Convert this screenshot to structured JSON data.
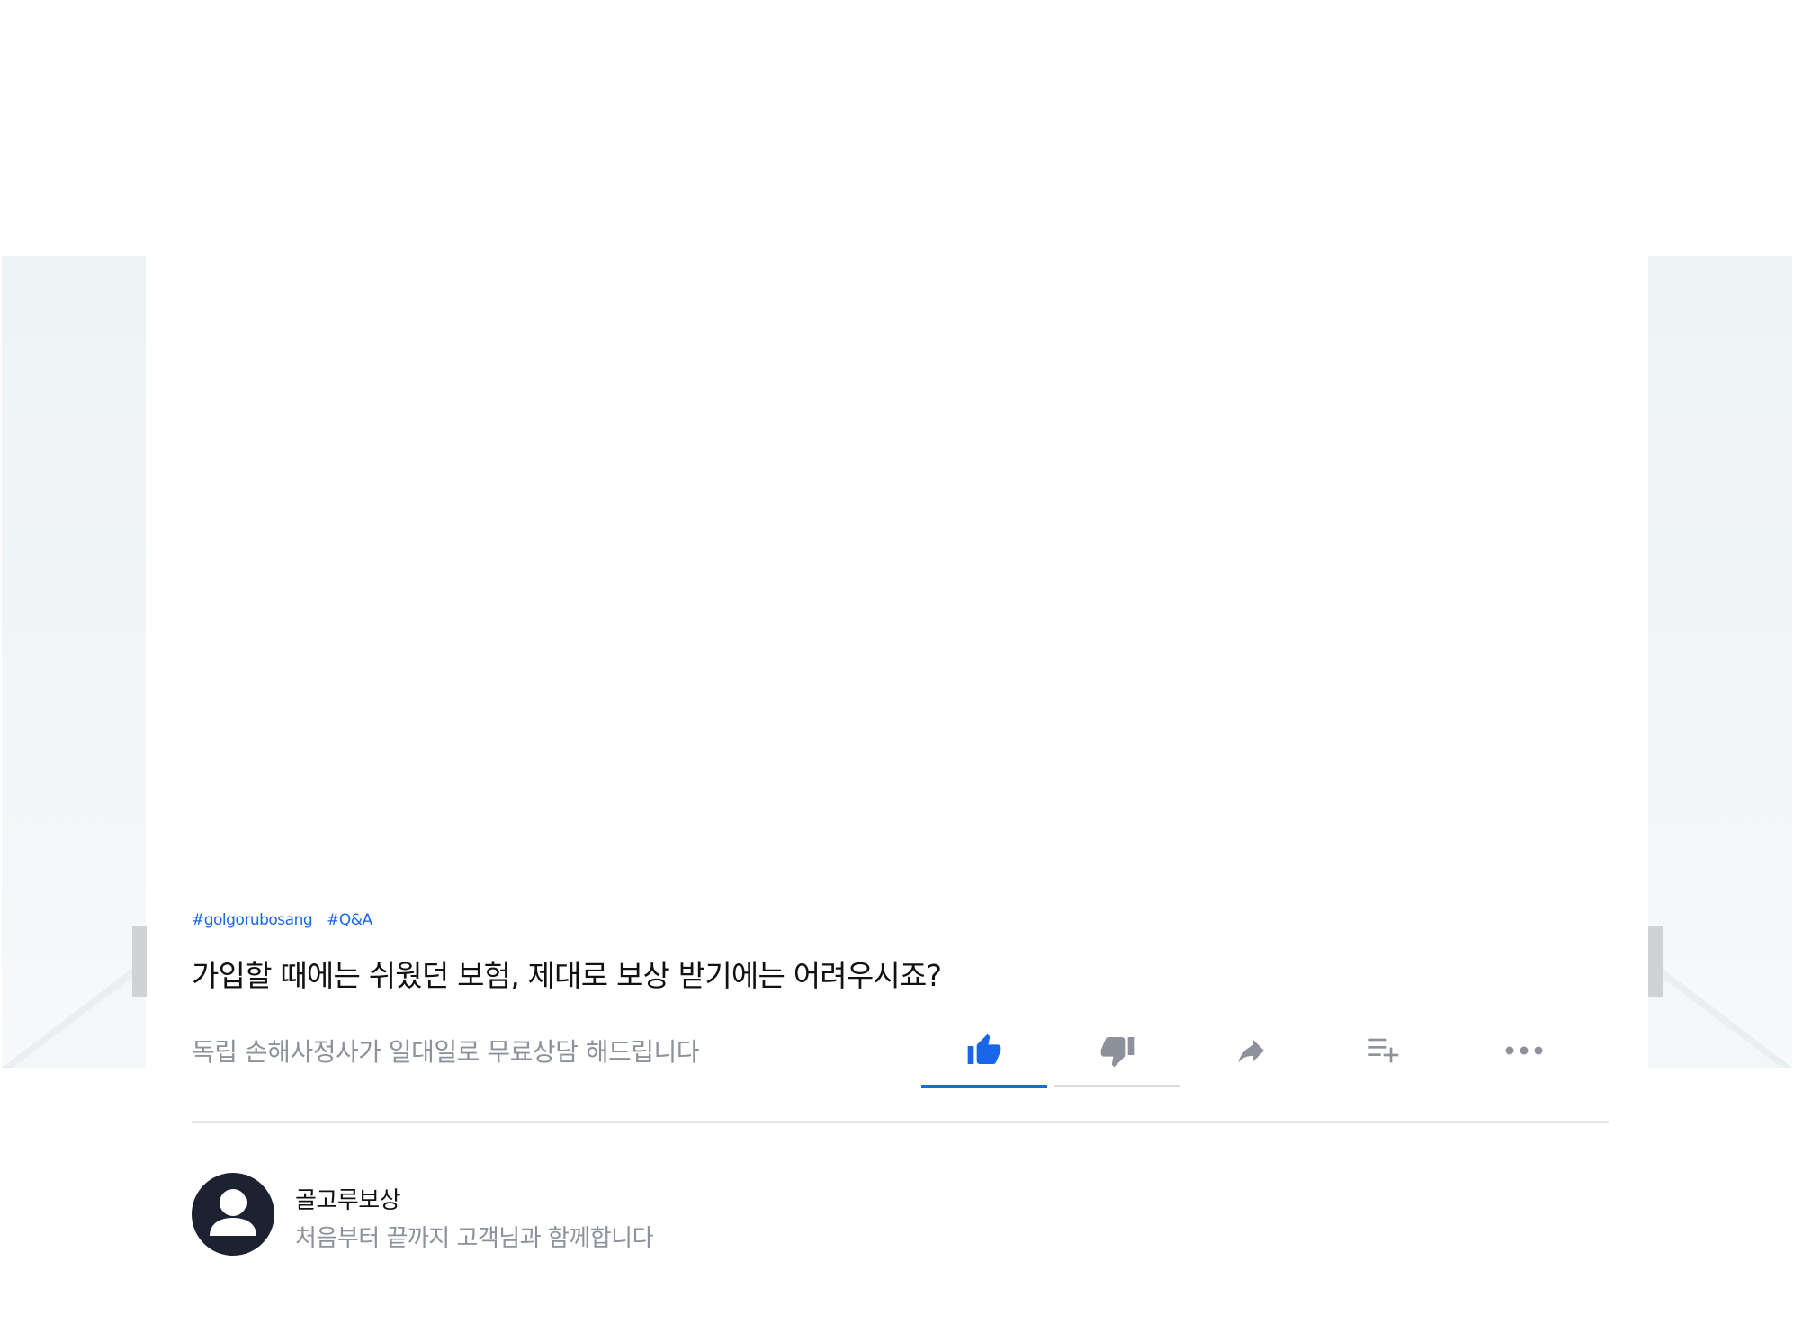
{
  "video": {
    "tags": [
      "#golgorubosang",
      "#Q&A"
    ],
    "title": "가입할 때에는 쉬웠던 보험, 제대로 보상 받기에는 어려우시죠?",
    "subtitle": "독립 손해사정사가 일대일로 무료상담 해드립니다"
  },
  "actions": [
    {
      "name": "like",
      "icon": "thumbs-up-icon",
      "active": true
    },
    {
      "name": "dislike",
      "icon": "thumbs-down-icon",
      "active": false
    },
    {
      "name": "share",
      "icon": "share-arrow-icon",
      "active": false
    },
    {
      "name": "add-to-playlist",
      "icon": "playlist-add-icon",
      "active": false
    },
    {
      "name": "more",
      "icon": "more-horizontal-icon",
      "active": false
    }
  ],
  "channel": {
    "name": "골고루보상",
    "description": "처음부터 끝까지 고객님과 함께합니다",
    "avatar_icon": "person-icon"
  },
  "colors": {
    "accent": "#1a66e8",
    "title_text": "#111111",
    "secondary_text": "#8c919c",
    "icon_gray": "#8c919c",
    "avatar_bg": "#1c2230"
  }
}
